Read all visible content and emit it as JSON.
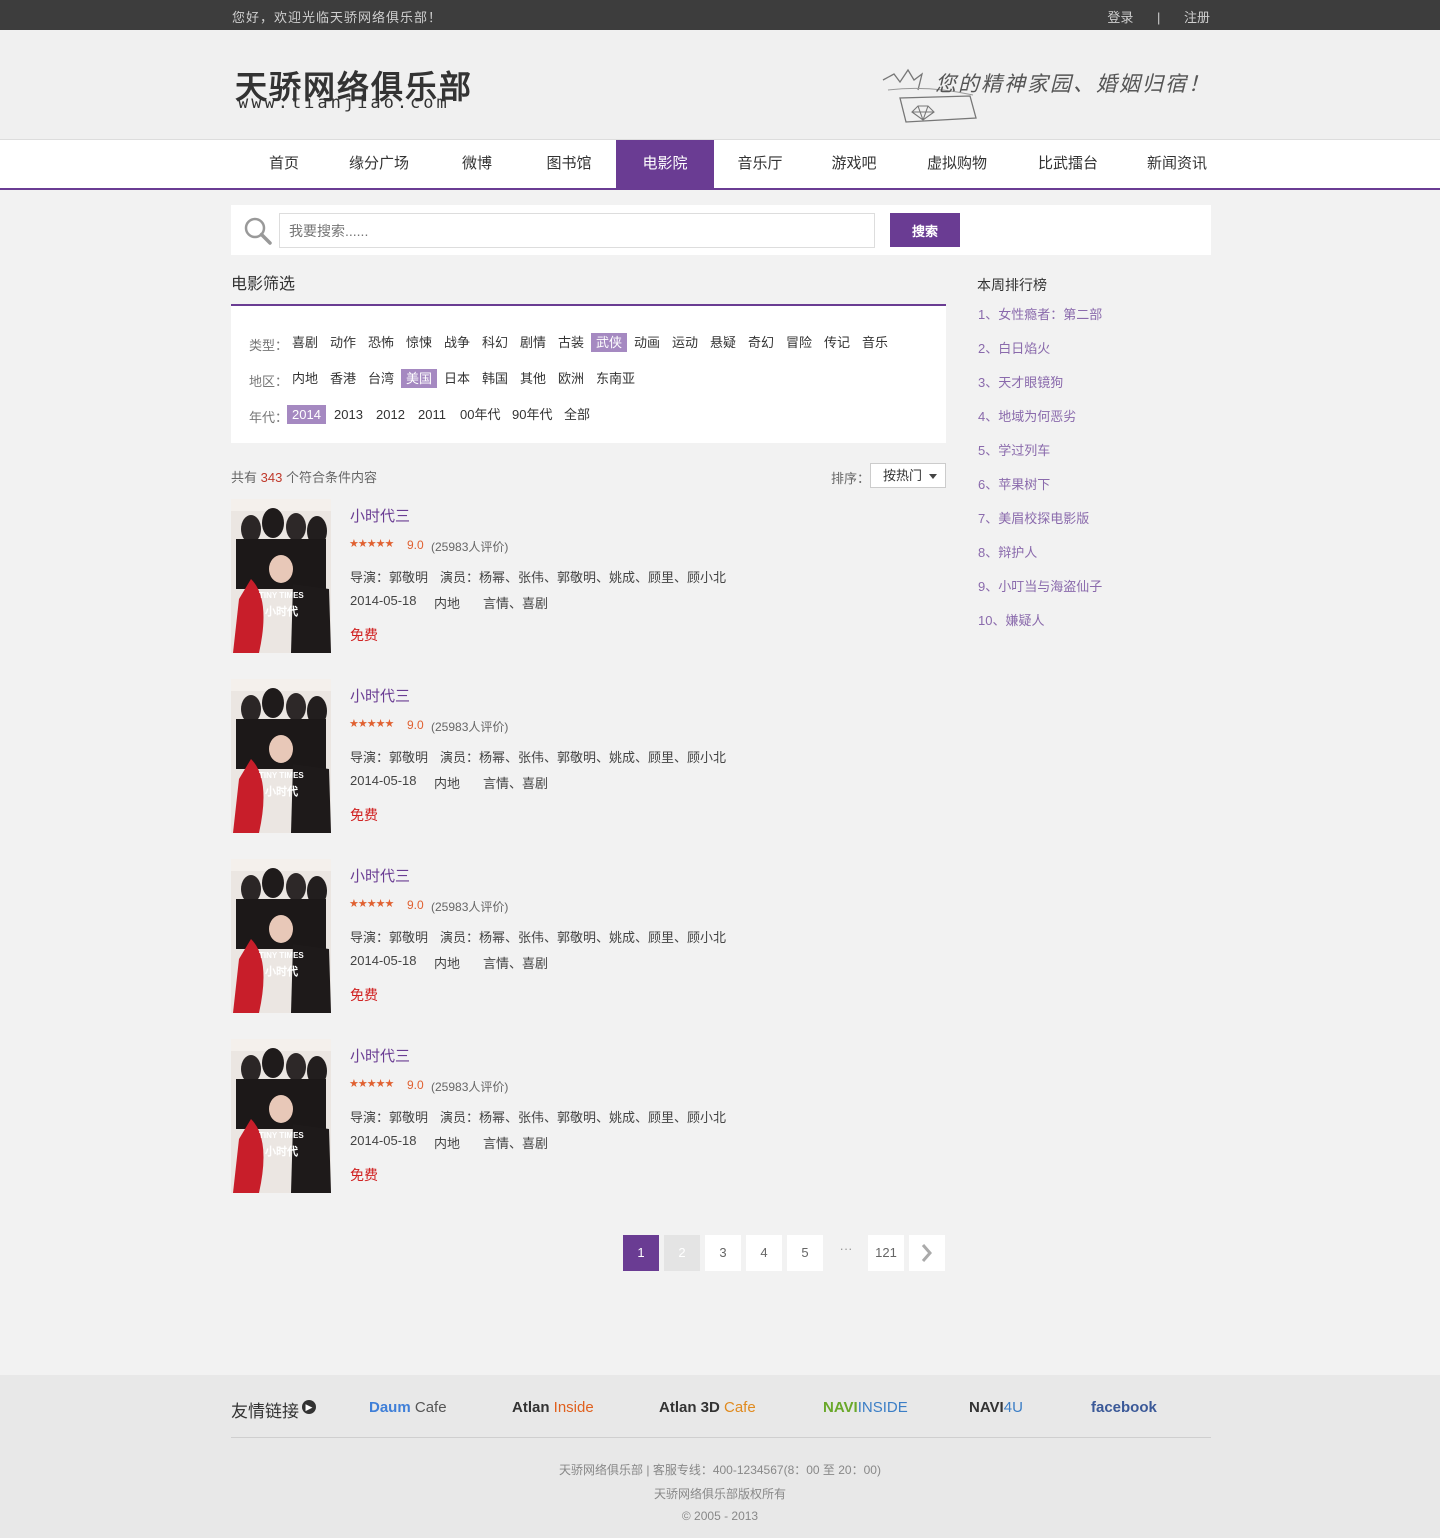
{
  "topbar": {
    "welcome": "您好，欢迎光临天骄网络俱乐部！",
    "login": "登录",
    "separator": "|",
    "register": "注册"
  },
  "header": {
    "logo_cn": "天骄网络俱乐部",
    "logo_en": "www.tianjiao.com",
    "slogan": "您的精神家园、婚姻归宿！"
  },
  "nav": {
    "items": [
      "首页",
      "缘分广场",
      "微博",
      "图书馆",
      "电影院",
      "音乐厅",
      "游戏吧",
      "虚拟购物",
      "比武擂台",
      "新闻资讯"
    ],
    "active": "电影院"
  },
  "search": {
    "placeholder": "我要搜索......",
    "button": "搜索"
  },
  "filter": {
    "title": "电影筛选",
    "type_label": "类型：",
    "types": [
      "喜剧",
      "动作",
      "恐怖",
      "惊悚",
      "战争",
      "科幻",
      "剧情",
      "古装",
      "武侠",
      "动画",
      "运动",
      "悬疑",
      "奇幻",
      "冒险",
      "传记",
      "音乐"
    ],
    "type_selected": "武侠",
    "region_label": "地区：",
    "regions": [
      "内地",
      "香港",
      "台湾",
      "美国",
      "日本",
      "韩国",
      "其他",
      "欧洲",
      "东南亚"
    ],
    "region_selected": "美国",
    "year_label": "年代：",
    "years": [
      "2014",
      "2013",
      "2012",
      "2011",
      "00年代",
      "90年代",
      "全部"
    ],
    "year_selected": "2014"
  },
  "results": {
    "prefix": "共有",
    "count": "343",
    "suffix": "个符合条件内容",
    "sort_label": "排序：",
    "sort_value": "按热门"
  },
  "movies": [
    {
      "title": "小时代三",
      "stars": "★★★★★",
      "score": "9.0",
      "votes": "(25983人评价)",
      "director": "导演：郭敬明",
      "actors": "演员：杨幂、张伟、郭敬明、姚成、顾里、顾小北",
      "date": "2014-05-18",
      "region": "内地",
      "genre": "言情、喜剧",
      "price": "免费",
      "rating": 4.5
    },
    {
      "title": "小时代三",
      "stars": "★★★★★",
      "score": "9.0",
      "votes": "(25983人评价)",
      "director": "导演：郭敬明",
      "actors": "演员：杨幂、张伟、郭敬明、姚成、顾里、顾小北",
      "date": "2014-05-18",
      "region": "内地",
      "genre": "言情、喜剧",
      "price": "免费",
      "rating": 4.5
    },
    {
      "title": "小时代三",
      "stars": "★★★★★",
      "score": "9.0",
      "votes": "(25983人评价)",
      "director": "导演：郭敬明",
      "actors": "演员：杨幂、张伟、郭敬明、姚成、顾里、顾小北",
      "date": "2014-05-18",
      "region": "内地",
      "genre": "言情、喜剧",
      "price": "免费",
      "rating": 4.5
    },
    {
      "title": "小时代三",
      "stars": "★★★★★",
      "score": "9.0",
      "votes": "(25983人评价)",
      "director": "导演：郭敬明",
      "actors": "演员：杨幂、张伟、郭敬明、姚成、顾里、顾小北",
      "date": "2014-05-18",
      "region": "内地",
      "genre": "言情、喜剧",
      "price": "免费",
      "rating": 4.5
    }
  ],
  "poster": {
    "brand": "TINY TIMES",
    "title": "小时代"
  },
  "pagination": {
    "pages": [
      "1",
      "2",
      "3",
      "4",
      "5"
    ],
    "ellipsis": "···",
    "last": "121",
    "current": "1"
  },
  "ranking": {
    "title": "本周排行榜",
    "items": [
      "1、女性瘾者：第二部",
      "2、白日焰火",
      "3、天才眼镜狗",
      "4、地域为何恶劣",
      "5、学过列车",
      "6、苹果树下",
      "7、美眉校探电影版",
      "8、辩护人",
      "9、小叮当与海盗仙子",
      "10、嫌疑人"
    ]
  },
  "footer": {
    "friend_label": "友情链接",
    "partners": [
      {
        "a": "Daum",
        "b": " Cafe",
        "color_a": "#3f7fd8",
        "color_b": "#555555"
      },
      {
        "a": "Atlan",
        "b": " Inside",
        "color_a": "#333333",
        "color_b": "#e0601e"
      },
      {
        "a": "Atlan 3D",
        "b": " Cafe",
        "color_a": "#333333",
        "color_b": "#e08a1e"
      },
      {
        "a": "NAVI",
        "b": "INSIDE",
        "color_a": "#6aa82a",
        "color_b": "#3b7ec6"
      },
      {
        "a": "NAVI",
        "b": "4U",
        "color_a": "#333333",
        "color_b": "#3b7ec6"
      },
      {
        "a": "facebook",
        "b": "",
        "color_a": "#3b5998",
        "color_b": "#3b5998"
      }
    ],
    "line1": "天骄网络俱乐部  |  客服专线：400-1234567(8：00 至 20：00)",
    "line2": "天骄网络俱乐部版权所有",
    "line3": "© 2005 - 2013"
  },
  "colors": {
    "accent": "#6a3c93",
    "accent_light": "#a589c1",
    "rank_link": "#8a6aac",
    "price": "#d02020",
    "star": "#e06030"
  }
}
